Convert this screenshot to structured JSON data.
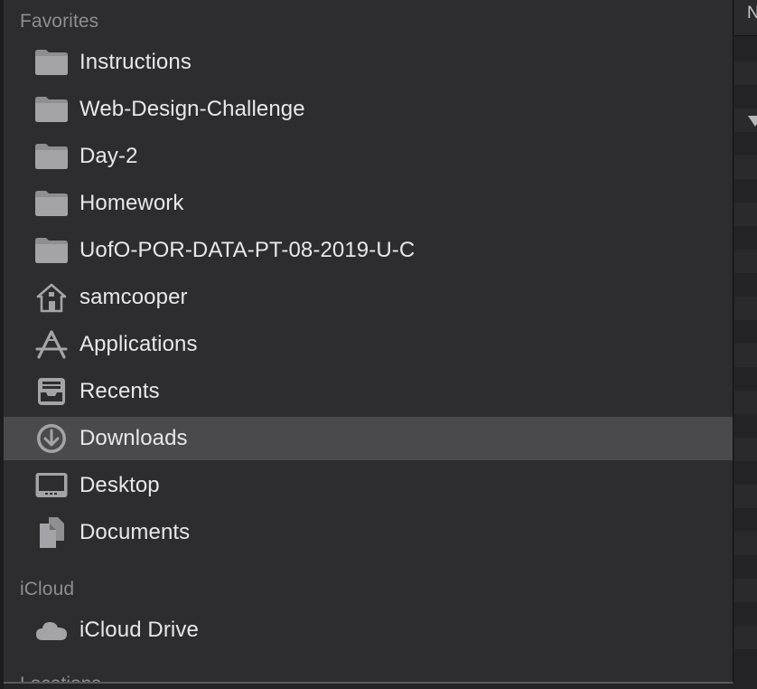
{
  "sidebar": {
    "favorites_header": "Favorites",
    "icloud_header": "iCloud",
    "locations_header": "Locations",
    "favorites": [
      {
        "label": "Instructions",
        "icon": "folder-icon"
      },
      {
        "label": "Web-Design-Challenge",
        "icon": "folder-icon"
      },
      {
        "label": "Day-2",
        "icon": "folder-icon"
      },
      {
        "label": "Homework",
        "icon": "folder-icon"
      },
      {
        "label": "UofO-POR-DATA-PT-08-2019-U-C",
        "icon": "folder-icon"
      },
      {
        "label": "samcooper",
        "icon": "home-icon"
      },
      {
        "label": "Applications",
        "icon": "applications-icon"
      },
      {
        "label": "Recents",
        "icon": "recents-icon"
      },
      {
        "label": "Downloads",
        "icon": "downloads-icon",
        "selected": true
      },
      {
        "label": "Desktop",
        "icon": "desktop-icon"
      },
      {
        "label": "Documents",
        "icon": "documents-icon"
      }
    ],
    "icloud": [
      {
        "label": "iCloud Drive",
        "icon": "cloud-icon"
      }
    ]
  },
  "file_list": {
    "column_header": "N"
  },
  "colors": {
    "sidebar_bg": "#2d2d2f",
    "selected_bg": "#4a4a4d",
    "section_header": "#8e8e93",
    "item_text": "#e8e8ea",
    "icon": "#a4a4a8"
  }
}
